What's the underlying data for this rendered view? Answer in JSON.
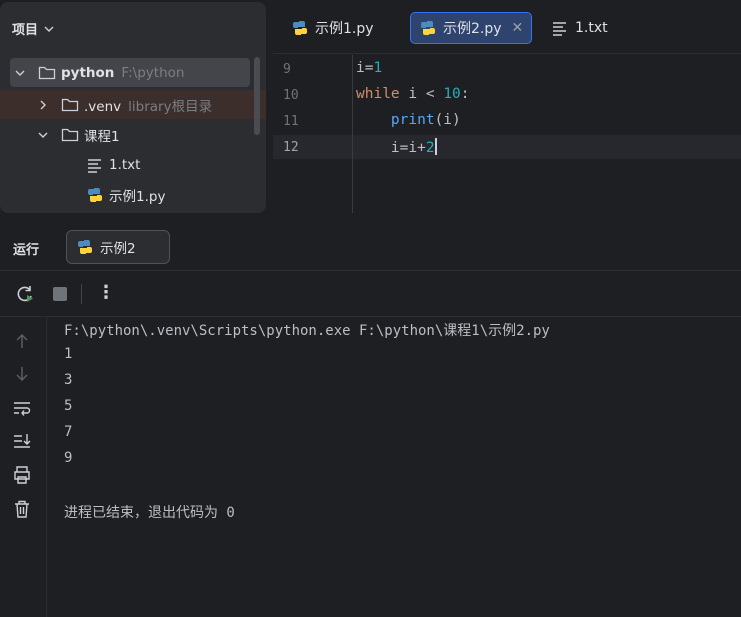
{
  "project": {
    "header": "项目",
    "root": {
      "label": "python",
      "hint": "F:\\python"
    },
    "venv": {
      "label": ".venv",
      "hint": "library根目录"
    },
    "course": {
      "label": "课程1"
    },
    "txt": {
      "label": "1.txt"
    },
    "example1": {
      "label": "示例1.py"
    }
  },
  "editor": {
    "tabs": [
      {
        "label": "示例1.py"
      },
      {
        "label": "示例2.py"
      },
      {
        "label": "1.txt"
      }
    ],
    "line_numbers": [
      "9",
      "10",
      "11",
      "12"
    ],
    "lines": [
      {
        "a": "i=",
        "b": "1"
      },
      {
        "kw": "while",
        "mid": " i < ",
        "num": "10",
        "end": ":"
      },
      {
        "fn": "print",
        "rest": "(i)"
      },
      {
        "a": "i=i+",
        "b": "2"
      }
    ]
  },
  "run": {
    "title": "运行",
    "tab_label": "示例2",
    "console": [
      "F:\\python\\.venv\\Scripts\\python.exe F:\\python\\课程1\\示例2.py",
      "1",
      "3",
      "5",
      "7",
      "9",
      "",
      "进程已结束，退出代码为 0"
    ]
  },
  "colors": {
    "background": "#1e1f22",
    "panel": "#2b2d30",
    "accent": "#3574f0",
    "keyword": "#cf8e6d",
    "number": "#2aacb8",
    "function": "#56a8f5"
  },
  "icons": [
    "chevron-down-icon",
    "folder-icon",
    "python-file-icon",
    "text-file-icon",
    "rerun-icon",
    "stop-icon",
    "more-icon",
    "arrow-up-icon",
    "arrow-down-icon",
    "soft-wrap-icon",
    "scroll-to-end-icon",
    "print-icon",
    "trash-icon",
    "close-icon"
  ]
}
